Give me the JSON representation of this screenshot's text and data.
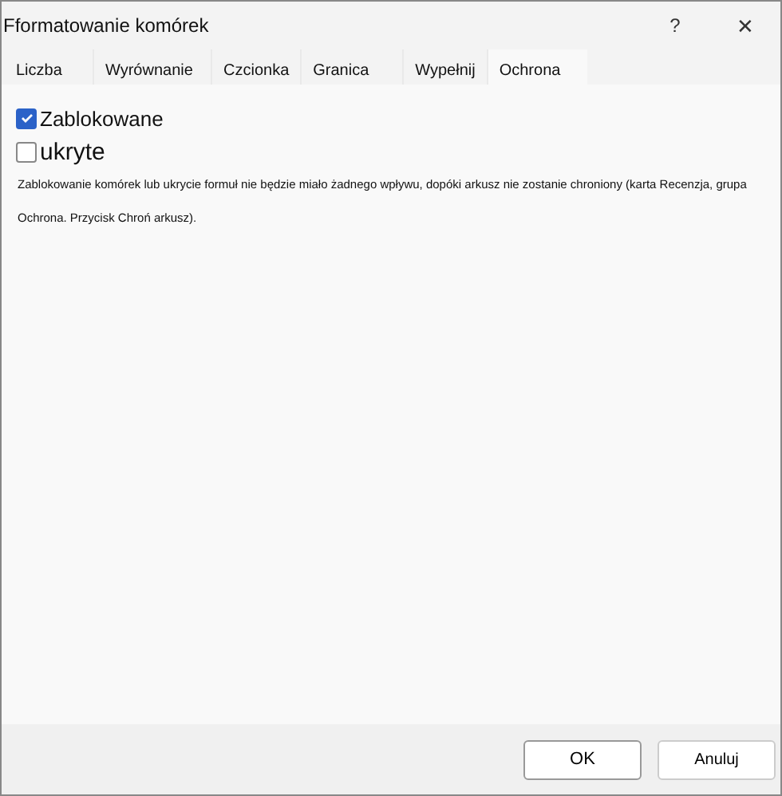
{
  "window": {
    "title": "Fformatowanie komórek",
    "help": "?",
    "close": "✕"
  },
  "tabs": [
    {
      "label": "Liczba",
      "selected": false
    },
    {
      "label": "Wyrównanie",
      "selected": false
    },
    {
      "label": "Czcionka",
      "selected": false
    },
    {
      "label": "Granica",
      "selected": false
    },
    {
      "label": "Wypełnij",
      "selected": false
    },
    {
      "label": "Ochrona",
      "selected": true
    }
  ],
  "options": [
    {
      "label": "Zablokowane",
      "checked": true
    },
    {
      "label": "ukryte",
      "checked": false
    }
  ],
  "note": "Zablokowanie komórek lub ukrycie formuł nie będzie miało żadnego wpływu, dopóki arkusz nie zostanie chroniony (karta Recenzja, grupa Ochrona. Przycisk Chroń arkusz).",
  "buttons": [
    "OK",
    "Anuluj"
  ]
}
